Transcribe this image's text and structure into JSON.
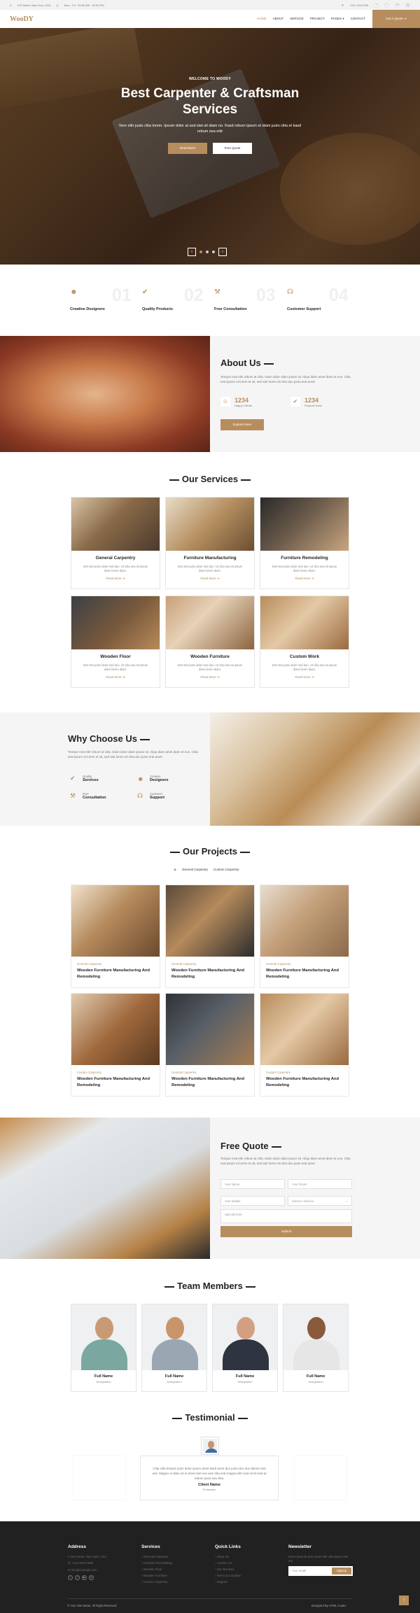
{
  "topbar": {
    "address": "123 Street, New York, USA",
    "hours": "Mon - Fri : 09.00 AM - 09.00 PM",
    "phone": "+012 345 6789",
    "socials": [
      "f",
      "t",
      "in",
      "ig"
    ]
  },
  "nav": {
    "logo": "WooDY",
    "items": [
      "HOME",
      "ABOUT",
      "SERVICE",
      "PROJECT",
      "PAGES ▾",
      "CONTACT"
    ],
    "quote": "Get A Quote ➜"
  },
  "hero": {
    "small": "WELCOME TO WOODY",
    "title_line1": "Best Carpenter & Craftsman",
    "title_line2": "Services",
    "text": "Vero elitr justo clita lorem. Ipsum dolor at sed stet sit diam no. Kasd rebum ipsum et diam justo clita et kasd rebum sea elitr",
    "btn1": "Read More",
    "btn2": "Free Quote",
    "prev": "‹",
    "next": "›"
  },
  "features": [
    {
      "num": "01",
      "label": "Creative Designers"
    },
    {
      "num": "02",
      "label": "Quality Products"
    },
    {
      "num": "03",
      "label": "Free Consultation"
    },
    {
      "num": "04",
      "label": "Customer Support"
    }
  ],
  "about": {
    "title": "About Us",
    "text": "Tempor erat elitr rebum at clita. Diam dolor diam ipsum sit. Aliqu diam amet diam et eos. Clita erat ipsum et lorem et sit, sed stet lorem sit clita duo justo erat amet",
    "stat1_value": "1234",
    "stat1_label": "Happy Clients",
    "stat2_value": "1234",
    "stat2_label": "Projects Done",
    "btn": "Explore More"
  },
  "services": {
    "title": "Our Services",
    "items": [
      {
        "title": "General Carpentry",
        "desc": "Stet stet justo dolor sed duo. Ut clita sea sit ipsum diam lorem diam.",
        "more": "Read More ➜"
      },
      {
        "title": "Furniture Manufacturing",
        "desc": "Stet stet justo dolor sed duo. Ut clita sea sit ipsum diam lorem diam.",
        "more": "Read More ➜"
      },
      {
        "title": "Furniture Remodeling",
        "desc": "Stet stet justo dolor sed duo. Ut clita sea sit ipsum diam lorem diam.",
        "more": "Read More ➜"
      },
      {
        "title": "Wooden Floor",
        "desc": "Stet stet justo dolor sed duo. Ut clita sea sit ipsum diam lorem diam.",
        "more": "Read More ➜"
      },
      {
        "title": "Wooden Furniture",
        "desc": "Stet stet justo dolor sed duo. Ut clita sea sit ipsum diam lorem diam.",
        "more": "Read More ➜"
      },
      {
        "title": "Custom Work",
        "desc": "Stet stet justo dolor sed duo. Ut clita sea sit ipsum diam lorem diam.",
        "more": "Read More ➜"
      }
    ]
  },
  "why": {
    "title": "Why Choose Us",
    "text": "Tempor erat elitr rebum at clita. Diam dolor diam ipsum sit. Aliqu diam amet diam et eos. Clita erat ipsum et lorem et sit, sed stet lorem sit clita duo justo erat amet",
    "items": [
      {
        "a": "Quality",
        "b": "Services"
      },
      {
        "a": "Creative",
        "b": "Designers"
      },
      {
        "a": "Free",
        "b": "Consultation"
      },
      {
        "a": "Customer",
        "b": "Support"
      }
    ]
  },
  "projects": {
    "title": "Our Projects",
    "filters": [
      "General Carpentry",
      "Custom Carpentry"
    ],
    "items": [
      {
        "cat": "General Carpentry",
        "title": "Wooden Furniture Manufacturing And Remodeling"
      },
      {
        "cat": "General Carpentry",
        "title": "Wooden Furniture Manufacturing And Remodeling"
      },
      {
        "cat": "General Carpentry",
        "title": "Wooden Furniture Manufacturing And Remodeling"
      },
      {
        "cat": "Custom Carpentry",
        "title": "Wooden Furniture Manufacturing And Remodeling"
      },
      {
        "cat": "General Carpentry",
        "title": "Wooden Furniture Manufacturing And Remodeling"
      },
      {
        "cat": "Custom Carpentry",
        "title": "Wooden Furniture Manufacturing And Remodeling"
      }
    ]
  },
  "quote": {
    "title": "Free Quote",
    "text": "Tempor erat elitr rebum at clita. Diam dolor diam ipsum sit. Aliqu diam amet diam et eos. Clita erat ipsum et lorem et sit, sed stet lorem sit clita duo justo erat amet",
    "name": "Your Name",
    "email": "Your Email",
    "mobile": "Your Mobile",
    "service": "Select A Service",
    "note": "Special Note",
    "submit": "Submit"
  },
  "team": {
    "title": "Team Members",
    "members": [
      {
        "name": "Full Name",
        "role": "Designation"
      },
      {
        "name": "Full Name",
        "role": "Designation"
      },
      {
        "name": "Full Name",
        "role": "Designation"
      },
      {
        "name": "Full Name",
        "role": "Designation"
      }
    ]
  },
  "testimonial": {
    "title": "Testimonial",
    "text": "Clita clita tempor justo dolor ipsum amet kasd amet duo justo duo duo labore sed sed. Magna ut diam sit et amet stet eos sed clita erat magna elitr erat sit sit erat at rebum justo sea clita.",
    "name": "Client Name",
    "role": "Profession"
  },
  "footer": {
    "address_title": "Address",
    "address": [
      "123 Street, New York, USA",
      "+012 345 67890",
      "info@example.com"
    ],
    "services_title": "Services",
    "services": [
      "General Carpentry",
      "Furniture Remodeling",
      "Wooden Floor",
      "Wooden Furniture",
      "Custom Carpentry"
    ],
    "links_title": "Quick Links",
    "links": [
      "About Us",
      "Contact Us",
      "Our Services",
      "Terms & Condition",
      "Support"
    ],
    "news_title": "Newsletter",
    "news_text": "Dolor amet sit justo amet elitr clita ipsum elitr est.",
    "news_placeholder": "Your email",
    "news_btn": "SignUp",
    "copyright": "© Your Site Name, All Right Reserved.",
    "designed": "Designed By HTML Codex"
  },
  "colors": {
    "accent": "#b78d5e",
    "dark": "#212121",
    "light": "#f5f5f5"
  }
}
